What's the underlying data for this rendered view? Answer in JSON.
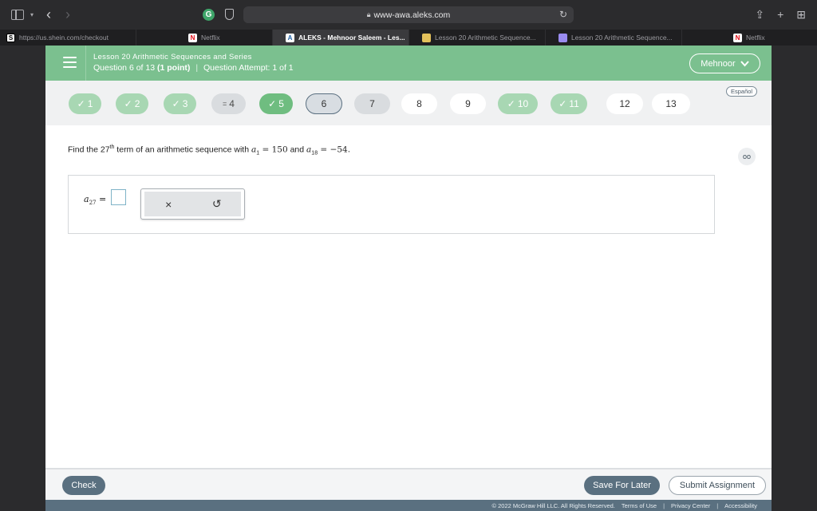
{
  "browser": {
    "url": "www-awa.aleks.com",
    "tabs": [
      {
        "label": "https://us.shein.com/checkout",
        "favicon": "S"
      },
      {
        "label": "Netflix",
        "favicon": "N"
      },
      {
        "label": "ALEKS - Mehnoor Saleem - Les...",
        "favicon": "A"
      },
      {
        "label": "Lesson 20 Arithmetic Sequence...",
        "favicon": ""
      },
      {
        "label": "Lesson 20 Arithmetic Sequence...",
        "favicon": ""
      },
      {
        "label": "Netflix",
        "favicon": "N"
      }
    ]
  },
  "header": {
    "lesson_title": "Lesson 20 Arithmetic Sequences and Series",
    "question_prefix": "Question 6 of 13",
    "points": "(1 point)",
    "attempt": "Question Attempt: 1 of 1",
    "user_name": "Mehnoor"
  },
  "question_nav": [
    {
      "label": "1",
      "mark": "✓"
    },
    {
      "label": "2",
      "mark": "✓"
    },
    {
      "label": "3",
      "mark": "✓"
    },
    {
      "label": "4",
      "mark": "="
    },
    {
      "label": "5",
      "mark": "✓"
    },
    {
      "label": "6",
      "mark": ""
    },
    {
      "label": "7",
      "mark": ""
    },
    {
      "label": "8",
      "mark": ""
    },
    {
      "label": "9",
      "mark": ""
    },
    {
      "label": "10",
      "mark": "✓"
    },
    {
      "label": "11",
      "mark": "✓"
    },
    {
      "label": "12",
      "mark": ""
    },
    {
      "label": "13",
      "mark": ""
    }
  ],
  "language_link": "Español",
  "problem": {
    "text_1": "Find the 27",
    "sup": "th",
    "text_2": " term of an arithmetic sequence with ",
    "var_a": "a",
    "sub_1": "1",
    "eq_1": " = 150",
    "text_3": " and ",
    "sub_18": "18",
    "eq_2": " = −54."
  },
  "answer": {
    "var": "a",
    "sub": "27",
    "equals": " =",
    "value": ""
  },
  "tools": {
    "clear_symbol": "×",
    "undo_symbol": "↺"
  },
  "footer": {
    "check_label": "Check",
    "save_label": "Save For Later",
    "submit_label": "Submit Assignment",
    "copyright": "© 2022 McGraw Hill LLC. All Rights Reserved.",
    "terms": "Terms of Use",
    "privacy": "Privacy Center",
    "accessibility": "Accessibility"
  }
}
